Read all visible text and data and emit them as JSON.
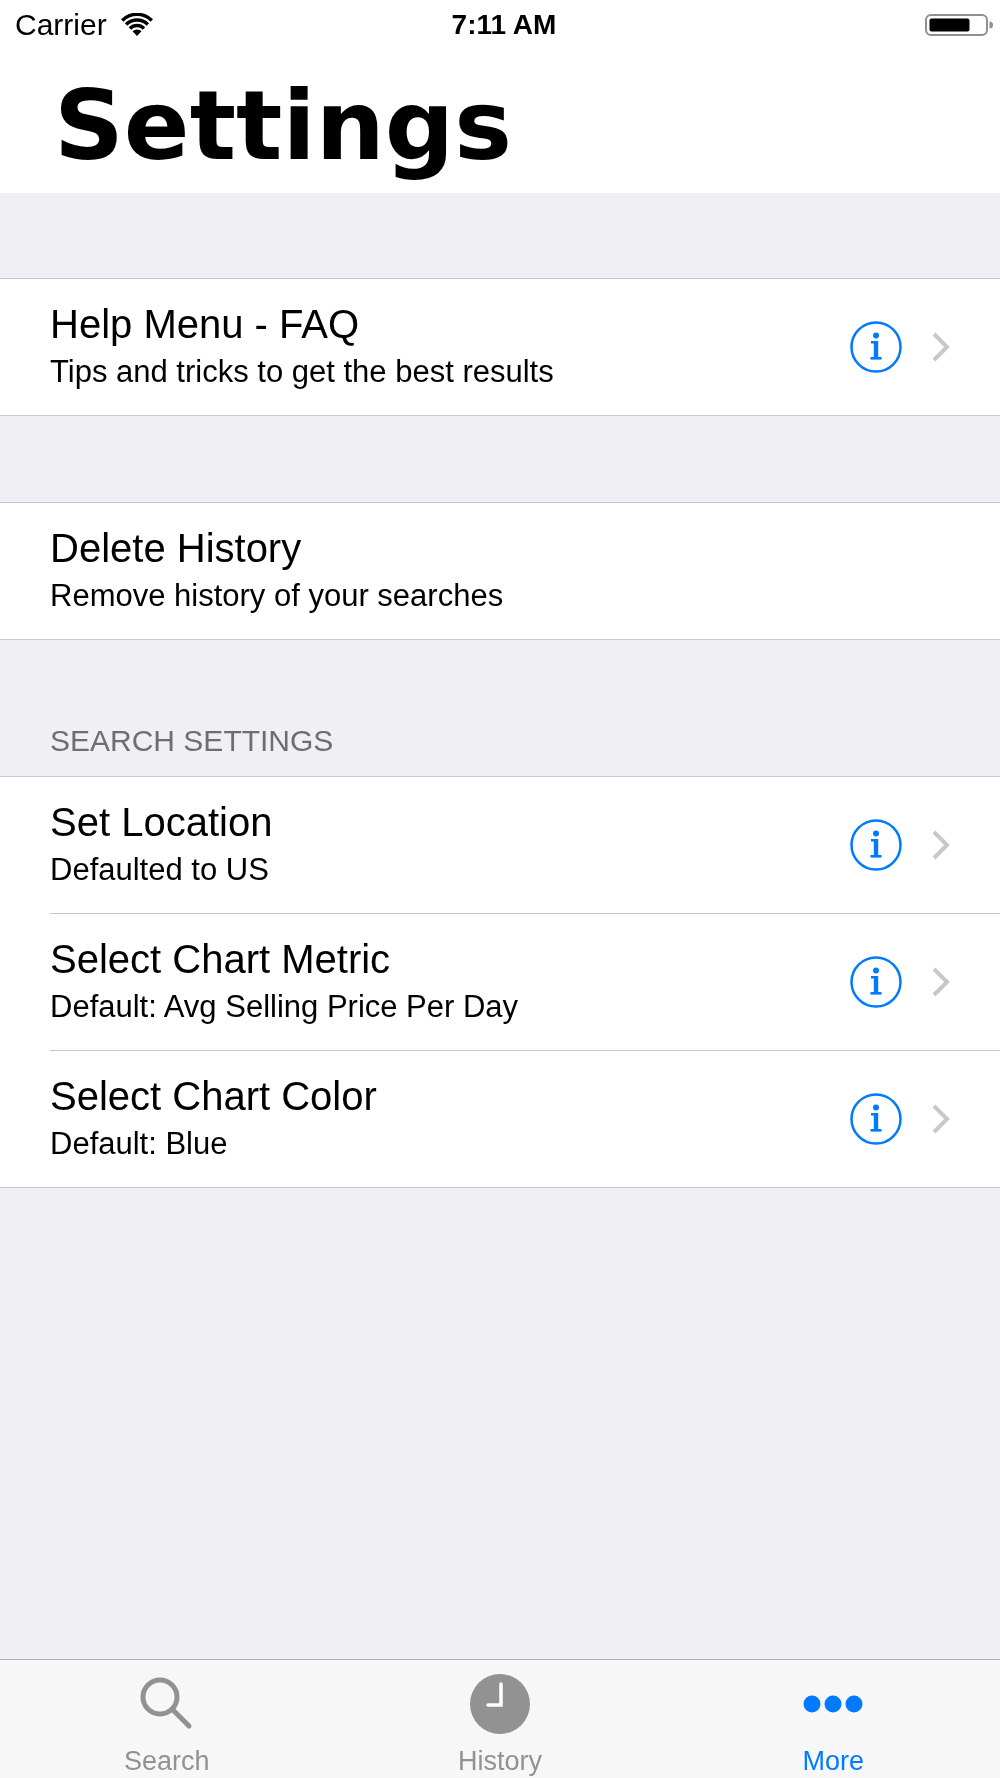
{
  "status_bar": {
    "carrier": "Carrier",
    "time": "7:11 AM"
  },
  "title": "Settings",
  "sections": [
    {
      "rows": [
        {
          "title": "Help Menu - FAQ",
          "subtitle": "Tips and tricks to get the best results",
          "info": true,
          "disclosure": true
        }
      ]
    },
    {
      "rows": [
        {
          "title": "Delete History",
          "subtitle": "Remove history of your searches",
          "info": false,
          "disclosure": false
        }
      ]
    },
    {
      "header": "SEARCH SETTINGS",
      "rows": [
        {
          "title": "Set Location",
          "subtitle": "Defaulted to US",
          "info": true,
          "disclosure": true
        },
        {
          "title": "Select Chart Metric",
          "subtitle": "Default: Avg Selling Price Per Day",
          "info": true,
          "disclosure": true
        },
        {
          "title": "Select Chart Color",
          "subtitle": "Default: Blue",
          "info": true,
          "disclosure": true
        }
      ]
    }
  ],
  "tab_bar": {
    "tabs": [
      {
        "kind": "search",
        "label": "Search",
        "selected": false
      },
      {
        "kind": "history",
        "label": "History",
        "selected": false
      },
      {
        "kind": "more",
        "label": "More",
        "selected": true
      }
    ]
  }
}
